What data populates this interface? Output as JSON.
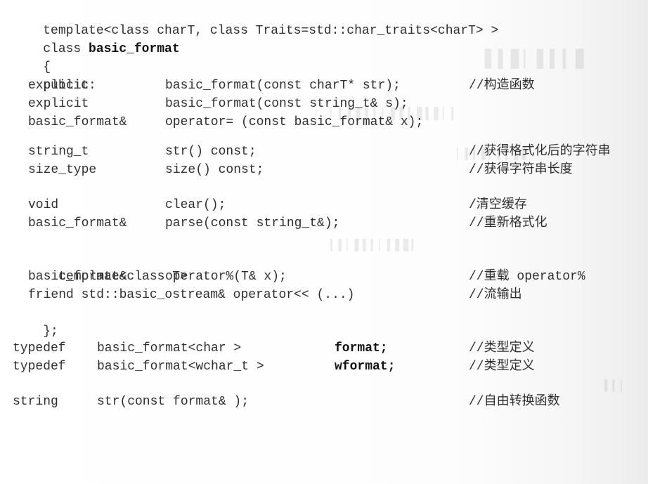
{
  "code": {
    "header_line1": "template<class charT, class Traits=std::char_traits<charT> >",
    "header_class_kw": "class ",
    "header_class_name": "basic_format",
    "open_brace": "{",
    "public_label": "public:",
    "ctor1": {
      "a": "explicit",
      "b": "basic_format(const charT* str);",
      "comment": "//构造函数"
    },
    "ctor2": {
      "a": "explicit",
      "b": "basic_format(const string_t& s);"
    },
    "assign": {
      "a": "basic_format&",
      "b": "operator= (const basic_format& x);"
    },
    "str_fn": {
      "a": "string_t",
      "b": "str() const;",
      "comment": "//获得格式化后的字符串"
    },
    "size_fn": {
      "a": "size_type",
      "b": "size() const;",
      "comment": "//获得字符串长度"
    },
    "clear_fn": {
      "a": "void",
      "b": "clear();",
      "comment": "/清空缓存"
    },
    "parse_fn": {
      "a": "basic_format&",
      "b": "parse(const string_t&);",
      "comment": "//重新格式化"
    },
    "tmpl": "template<class T>",
    "op_pct": {
      "a": "basic_format&",
      "b": "operator%(T& x);",
      "comment": "//重载 operator%"
    },
    "friend_line": "friend std::basic_ostream& operator<< (...)",
    "friend_comment": "//流输出",
    "close_brace": "};",
    "typedef1": {
      "kw": "typedef",
      "type": "basic_format<char >",
      "name": "format;",
      "comment": "//类型定义"
    },
    "typedef2": {
      "kw": "typedef",
      "type": "basic_format<wchar_t >",
      "name": "wformat;",
      "comment": "//类型定义"
    },
    "free_fn": {
      "kw": "string",
      "sig": "str(const format& );",
      "comment": "//自由转换函数"
    }
  }
}
